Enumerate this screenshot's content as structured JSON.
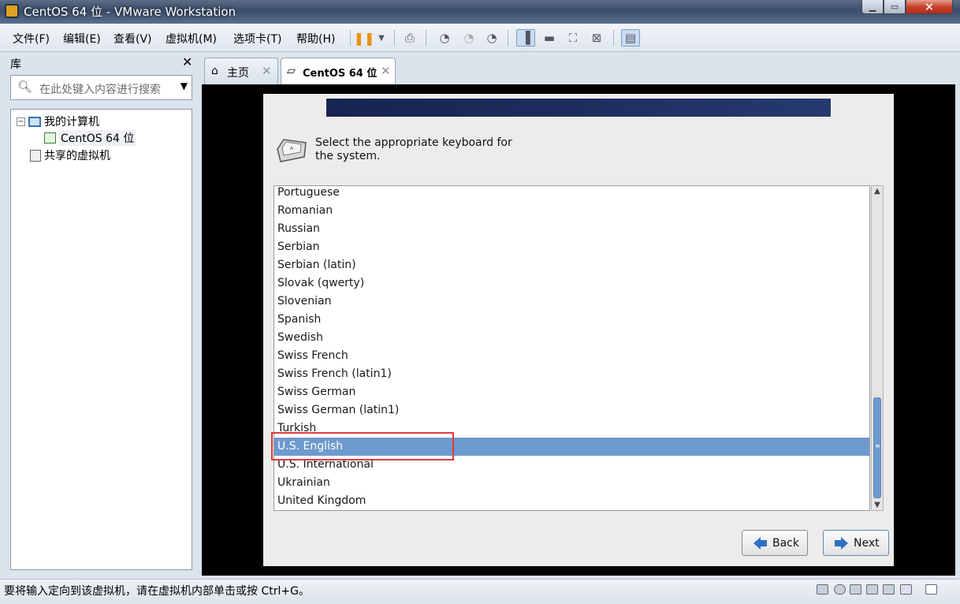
{
  "window": {
    "title": "CentOS 64 位 - VMware Workstation"
  },
  "menu": [
    "文件(F)",
    "编辑(E)",
    "查看(V)",
    "虚拟机(M)",
    "选项卡(T)",
    "帮助(H)"
  ],
  "library": {
    "title": "库",
    "search_placeholder": "在此处键入内容进行搜索",
    "tree": {
      "my_computer": "我的计算机",
      "vm": "CentOS 64 位",
      "shared": "共享的虚拟机"
    }
  },
  "tabs": [
    {
      "label": "主页",
      "active": false
    },
    {
      "label": "CentOS 64 位",
      "active": true
    }
  ],
  "installer": {
    "prompt": "Select the appropriate keyboard for the system.",
    "keyboards": [
      "Portuguese",
      "Romanian",
      "Russian",
      "Serbian",
      "Serbian (latin)",
      "Slovak (qwerty)",
      "Slovenian",
      "Spanish",
      "Swedish",
      "Swiss French",
      "Swiss French (latin1)",
      "Swiss German",
      "Swiss German (latin1)",
      "Turkish",
      "U.S. English",
      "U.S. International",
      "Ukrainian",
      "United Kingdom"
    ],
    "selected": "U.S. English",
    "back_label": "Back",
    "next_label": "Next"
  },
  "status": {
    "text": "要将输入定向到该虚拟机，请在虚拟机内部单击或按 Ctrl+G。"
  },
  "colors": {
    "selection": "#6d9acc",
    "annotation": "#e23b3b",
    "banner": "#1e2d5f"
  }
}
